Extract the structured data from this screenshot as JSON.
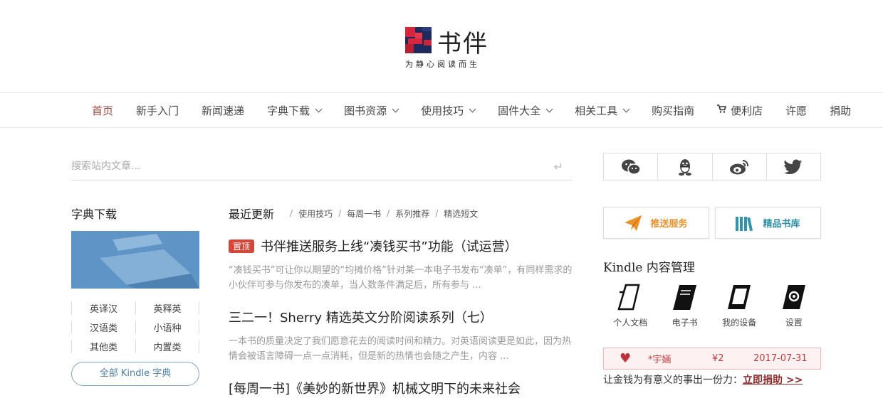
{
  "header": {
    "logo_text": "书伴",
    "tagline": "为静心阅读而生",
    "brand_colors": {
      "red": "#d7263d",
      "navy": "#1f2a5c"
    }
  },
  "nav": {
    "items": [
      {
        "label": "首页",
        "active": true
      },
      {
        "label": "新手入门"
      },
      {
        "label": "新闻速递"
      },
      {
        "label": "字典下载",
        "dropdown": true
      },
      {
        "label": "图书资源",
        "dropdown": true
      },
      {
        "label": "使用技巧",
        "dropdown": true
      },
      {
        "label": "固件大全",
        "dropdown": true
      },
      {
        "label": "相关工具",
        "dropdown": true
      },
      {
        "label": "购买指南"
      },
      {
        "label": "便利店",
        "icon": "cart-icon"
      },
      {
        "label": "许愿"
      },
      {
        "label": "捐助"
      }
    ],
    "active_color": "#a0453f"
  },
  "search": {
    "placeholder": "搜索站内文章..."
  },
  "sidebar": {
    "title": "字典下载",
    "dict_links": [
      [
        "英译汉",
        "英释英"
      ],
      [
        "汉语类",
        "小语种"
      ],
      [
        "其他类",
        "内置类"
      ]
    ],
    "all_button": "全部 Kindle 字典"
  },
  "latest": {
    "title": "最近更新",
    "crumbs": [
      "使用技巧",
      "每周一书",
      "系列推荐",
      "精选短文"
    ],
    "articles": [
      {
        "pin": "置顶",
        "title": "书伴推送服务上线“凑钱买书”功能（试运营）",
        "summary": "“凑钱买书”可让你以期望的“均摊价格”针对某一本电子书发布“凑单”，有同样需求的小伙伴可参与你发布的凑单，当人数条件满足后，所有参与 ..."
      },
      {
        "title": "三二一！Sherry 精选英文分阶阅读系列（七）",
        "summary": "一本书的质量决定了我们愿意花去的阅读时间和精力。对英语阅读更是如此，因为热情会被语言障碍一点一点消耗，但是新的热情也会随之产生，内容 ..."
      },
      {
        "title": "[每周一书]《美妙的新世界》机械文明下的未来社会",
        "summary": ""
      }
    ]
  },
  "right": {
    "social": [
      "wechat-icon",
      "qq-icon",
      "weibo-icon",
      "twitter-icon"
    ],
    "push_service": "推送服务",
    "premium_library": "精品书库",
    "kindle_title": "Kindle 内容管理",
    "kindle_items": [
      "个人文档",
      "电子书",
      "我的设备",
      "设置"
    ],
    "donation": {
      "name": "*宇婳",
      "amount": "¥2",
      "date": "2017-07-31"
    },
    "donate_text": "让金钱为有意义的事出一份力：",
    "donate_link": "立即捐助 >>"
  }
}
